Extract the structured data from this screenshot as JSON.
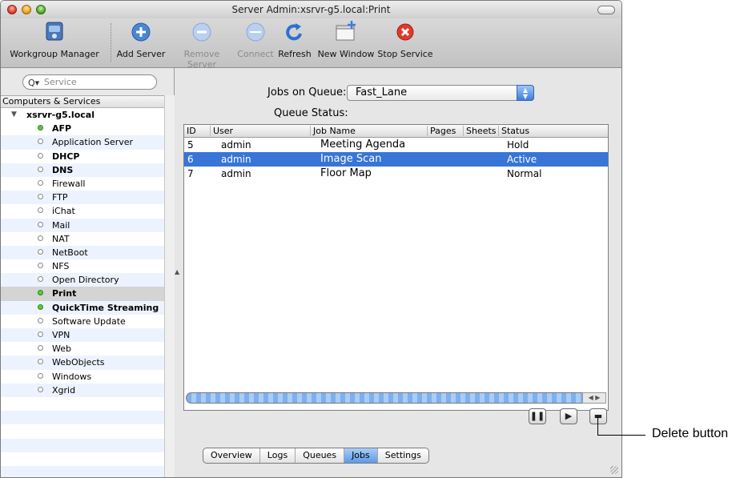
{
  "window": {
    "title": "Server Admin:xsrvr-g5.local:Print"
  },
  "toolbar": {
    "items": [
      {
        "label": "Workgroup Manager",
        "icon": "workgroup-manager-icon",
        "enabled": true
      },
      {
        "label": "Add Server",
        "icon": "add-server-icon",
        "enabled": true
      },
      {
        "label": "Remove Server",
        "icon": "remove-server-icon",
        "enabled": false
      },
      {
        "label": "Connect",
        "icon": "connect-icon",
        "enabled": false
      },
      {
        "label": "Refresh",
        "icon": "refresh-icon",
        "enabled": true
      },
      {
        "label": "New Window",
        "icon": "new-window-icon",
        "enabled": true
      },
      {
        "label": "Stop Service",
        "icon": "stop-service-icon",
        "enabled": true
      }
    ]
  },
  "sidebar": {
    "search_placeholder": "Service",
    "header": "Computers & Services",
    "server": "xsrvr-g5.local",
    "services": [
      {
        "name": "AFP",
        "running": true,
        "bold": true
      },
      {
        "name": "Application Server",
        "running": false,
        "bold": false
      },
      {
        "name": "DHCP",
        "running": false,
        "bold": true
      },
      {
        "name": "DNS",
        "running": false,
        "bold": true
      },
      {
        "name": "Firewall",
        "running": false,
        "bold": false
      },
      {
        "name": "FTP",
        "running": false,
        "bold": false
      },
      {
        "name": "iChat",
        "running": false,
        "bold": false
      },
      {
        "name": "Mail",
        "running": false,
        "bold": false
      },
      {
        "name": "NAT",
        "running": false,
        "bold": false
      },
      {
        "name": "NetBoot",
        "running": false,
        "bold": false
      },
      {
        "name": "NFS",
        "running": false,
        "bold": false
      },
      {
        "name": "Open Directory",
        "running": false,
        "bold": false
      },
      {
        "name": "Print",
        "running": true,
        "bold": true,
        "selected": true
      },
      {
        "name": "QuickTime Streaming",
        "running": true,
        "bold": true
      },
      {
        "name": "Software Update",
        "running": false,
        "bold": false
      },
      {
        "name": "VPN",
        "running": false,
        "bold": false
      },
      {
        "name": "Web",
        "running": false,
        "bold": false
      },
      {
        "name": "WebObjects",
        "running": false,
        "bold": false
      },
      {
        "name": "Windows",
        "running": false,
        "bold": false
      },
      {
        "name": "Xgrid",
        "running": false,
        "bold": false
      }
    ]
  },
  "main": {
    "jobs_on_queue_label": "Jobs on Queue:",
    "queue_selected": "Fast_Lane",
    "queue_status_label": "Queue Status:",
    "columns": [
      "ID",
      "User",
      "Job Name",
      "Pages",
      "Sheets",
      "Status"
    ],
    "jobs": [
      {
        "id": "5",
        "user": "admin",
        "job_name": "Meeting Agenda",
        "pages": "",
        "sheets": "",
        "status": "Hold",
        "selected": false
      },
      {
        "id": "6",
        "user": "admin",
        "job_name": "Image Scan",
        "pages": "",
        "sheets": "",
        "status": "Active",
        "selected": true
      },
      {
        "id": "7",
        "user": "admin",
        "job_name": "Floor Map",
        "pages": "",
        "sheets": "",
        "status": "Normal",
        "selected": false
      }
    ],
    "controls": {
      "pause": "pause-icon",
      "resume": "play-icon",
      "delete": "delete-icon"
    },
    "tabs": [
      {
        "label": "Overview",
        "active": false
      },
      {
        "label": "Logs",
        "active": false
      },
      {
        "label": "Queues",
        "active": false
      },
      {
        "label": "Jobs",
        "active": true
      },
      {
        "label": "Settings",
        "active": false
      }
    ]
  },
  "callout": {
    "text": "Delete button"
  },
  "colors": {
    "selection": "#3875d7",
    "running": "#5cc83c",
    "active_tab": "#5a9be8"
  }
}
